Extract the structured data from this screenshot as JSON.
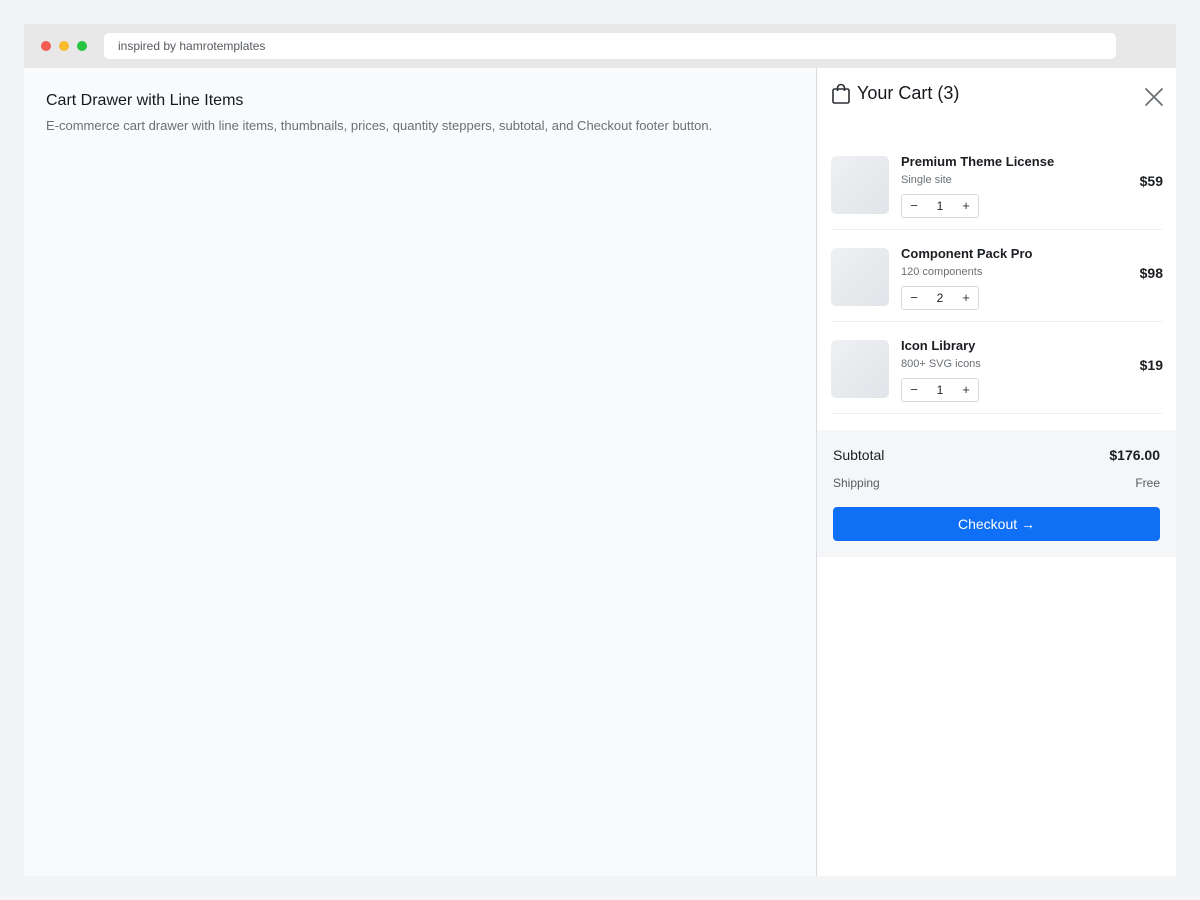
{
  "browser": {
    "url": "inspired by hamrotemplates"
  },
  "page": {
    "title": "Cart Drawer with Line Items",
    "description": "E-commerce cart drawer with line items, thumbnails, prices, quantity steppers, subtotal, and Checkout footer button."
  },
  "cart": {
    "title": "Your Cart (3)",
    "icons": {
      "cart": "shopping-bag-icon",
      "close": "close-icon"
    },
    "items": [
      {
        "name": "Premium Theme License",
        "subtitle": "Single site",
        "quantity": "1",
        "price": "$59",
        "minus": "−",
        "plus": "+"
      },
      {
        "name": "Component Pack Pro",
        "subtitle": "120 components",
        "quantity": "2",
        "price": "$98",
        "minus": "−",
        "plus": "+"
      },
      {
        "name": "Icon Library",
        "subtitle": "800+ SVG icons",
        "quantity": "1",
        "price": "$19",
        "minus": "−",
        "plus": "+"
      }
    ],
    "subtotal_label": "Subtotal",
    "subtotal_value": "$176.00",
    "shipping_label": "Shipping",
    "shipping_value": "Free",
    "checkout_label": "Checkout →"
  },
  "colors": {
    "accent": "#0f6ff5",
    "traffic_red": "#f45c56",
    "traffic_yellow": "#f9bc2e",
    "traffic_green": "#27c43f"
  }
}
